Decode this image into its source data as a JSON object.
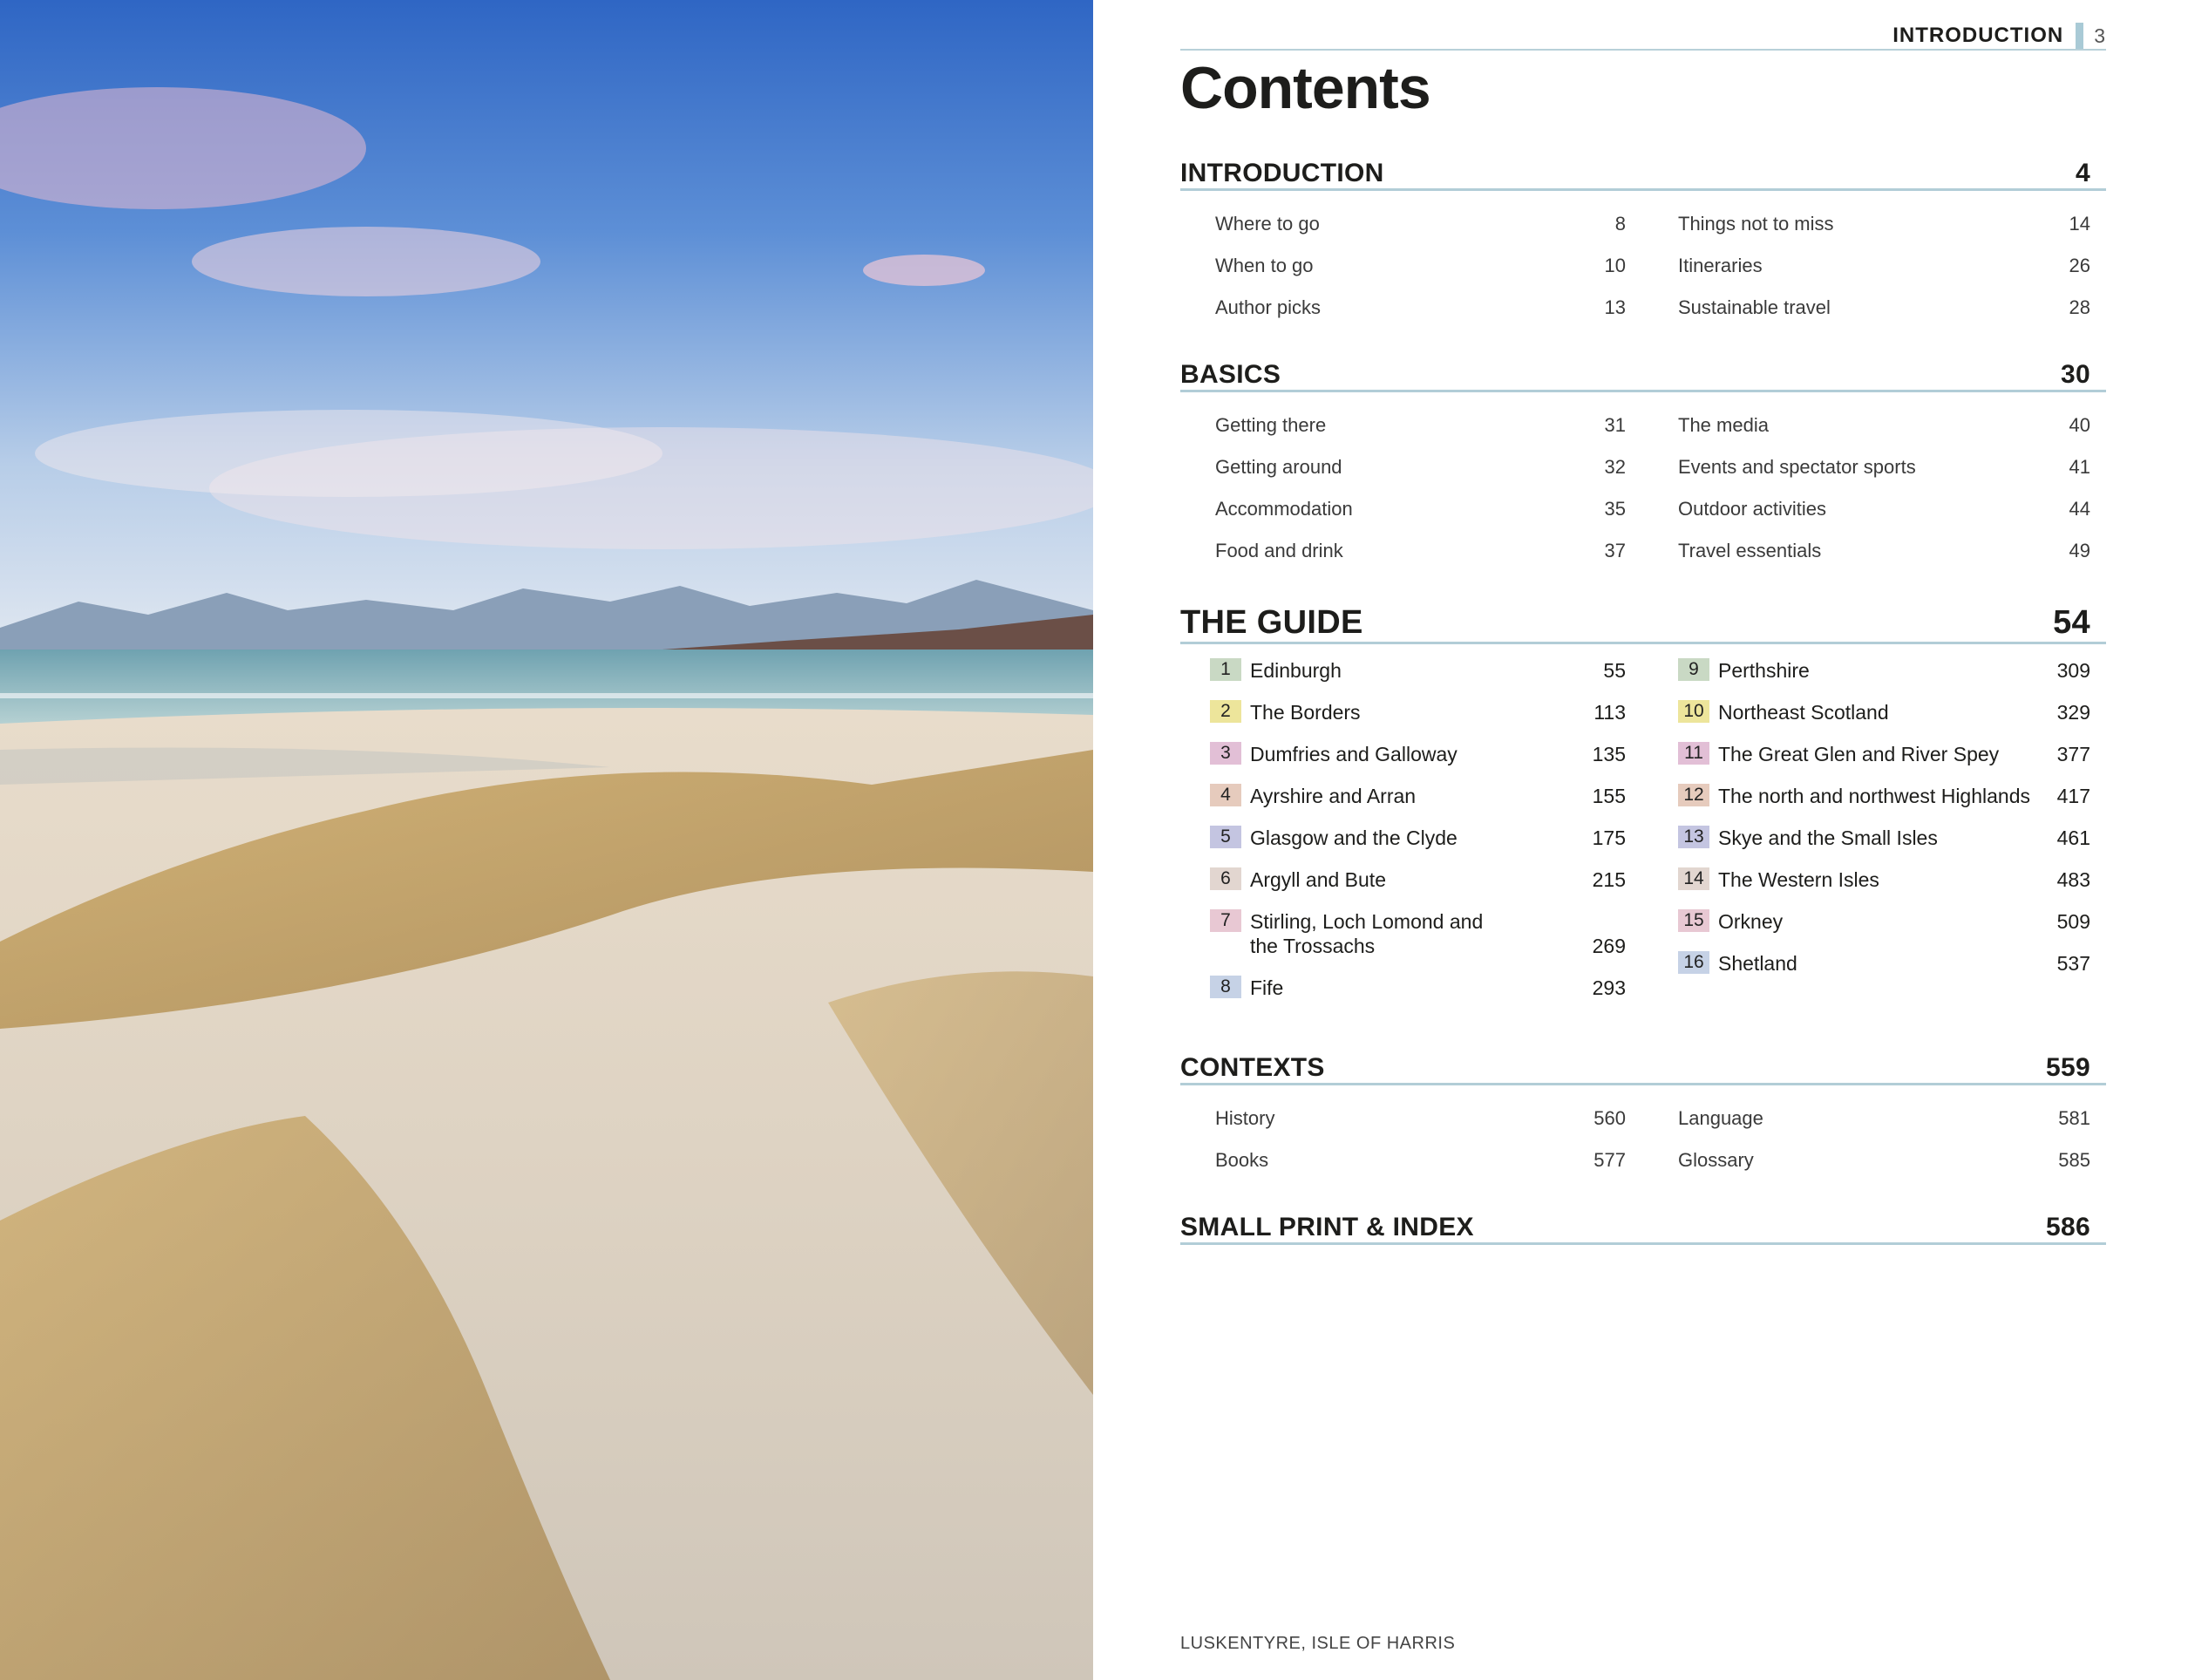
{
  "running_head": {
    "label": "INTRODUCTION",
    "page_number": "3"
  },
  "title": "Contents",
  "photo": {
    "caption": "LUSKENTYRE, ISLE OF HARRIS"
  },
  "sections": {
    "introduction": {
      "title": "INTRODUCTION",
      "page": "4",
      "left": [
        {
          "label": "Where to go",
          "page": "8"
        },
        {
          "label": "When to go",
          "page": "10"
        },
        {
          "label": "Author picks",
          "page": "13"
        }
      ],
      "right": [
        {
          "label": "Things not to miss",
          "page": "14"
        },
        {
          "label": "Itineraries",
          "page": "26"
        },
        {
          "label": "Sustainable travel",
          "page": "28"
        }
      ]
    },
    "basics": {
      "title": "BASICS",
      "page": "30",
      "left": [
        {
          "label": "Getting there",
          "page": "31"
        },
        {
          "label": "Getting around",
          "page": "32"
        },
        {
          "label": "Accommodation",
          "page": "35"
        },
        {
          "label": "Food and drink",
          "page": "37"
        }
      ],
      "right": [
        {
          "label": "The media",
          "page": "40"
        },
        {
          "label": "Events and spectator sports",
          "page": "41"
        },
        {
          "label": "Outdoor activities",
          "page": "44"
        },
        {
          "label": "Travel essentials",
          "page": "49"
        }
      ]
    },
    "guide": {
      "title": "THE GUIDE",
      "page": "54",
      "left": [
        {
          "num": "1",
          "label": "Edinburgh",
          "page": "55",
          "color": "#c9d9c4"
        },
        {
          "num": "2",
          "label": "The Borders",
          "page": "113",
          "color": "#ede59b"
        },
        {
          "num": "3",
          "label": "Dumfries and Galloway",
          "page": "135",
          "color": "#e2bfd6"
        },
        {
          "num": "4",
          "label": "Ayrshire and Arran",
          "page": "155",
          "color": "#e6cbbd"
        },
        {
          "num": "5",
          "label": "Glasgow and the Clyde",
          "page": "175",
          "color": "#c4c5e1"
        },
        {
          "num": "6",
          "label": "Argyll and Bute",
          "page": "215",
          "color": "#e2d6d0"
        },
        {
          "num": "7",
          "label": "Stirling, Loch Lomond and",
          "label2": "the Trossachs",
          "page": "269",
          "color": "#e8c8d3"
        },
        {
          "num": "8",
          "label": "Fife",
          "page": "293",
          "color": "#c6d2e6"
        }
      ],
      "right": [
        {
          "num": "9",
          "label": "Perthshire",
          "page": "309",
          "color": "#c9d9c4"
        },
        {
          "num": "10",
          "label": "Northeast Scotland",
          "page": "329",
          "color": "#ede59b"
        },
        {
          "num": "11",
          "label": "The Great Glen and River Spey",
          "page": "377",
          "color": "#e2bfd6"
        },
        {
          "num": "12",
          "label": "The north and northwest Highlands",
          "page": "417",
          "color": "#e6cbbd"
        },
        {
          "num": "13",
          "label": "Skye and the Small Isles",
          "page": "461",
          "color": "#c4c5e1"
        },
        {
          "num": "14",
          "label": "The Western Isles",
          "page": "483",
          "color": "#e2d6d0"
        },
        {
          "num": "15",
          "label": "Orkney",
          "page": "509",
          "color": "#e8c8d3"
        },
        {
          "num": "16",
          "label": "Shetland",
          "page": "537",
          "color": "#c6d2e6"
        }
      ]
    },
    "contexts": {
      "title": "CONTEXTS",
      "page": "559",
      "left": [
        {
          "label": "History",
          "page": "560"
        },
        {
          "label": "Books",
          "page": "577"
        }
      ],
      "right": [
        {
          "label": "Language",
          "page": "581"
        },
        {
          "label": "Glossary",
          "page": "585"
        }
      ]
    },
    "small_print": {
      "title": "SMALL PRINT & INDEX",
      "page": "586"
    }
  }
}
